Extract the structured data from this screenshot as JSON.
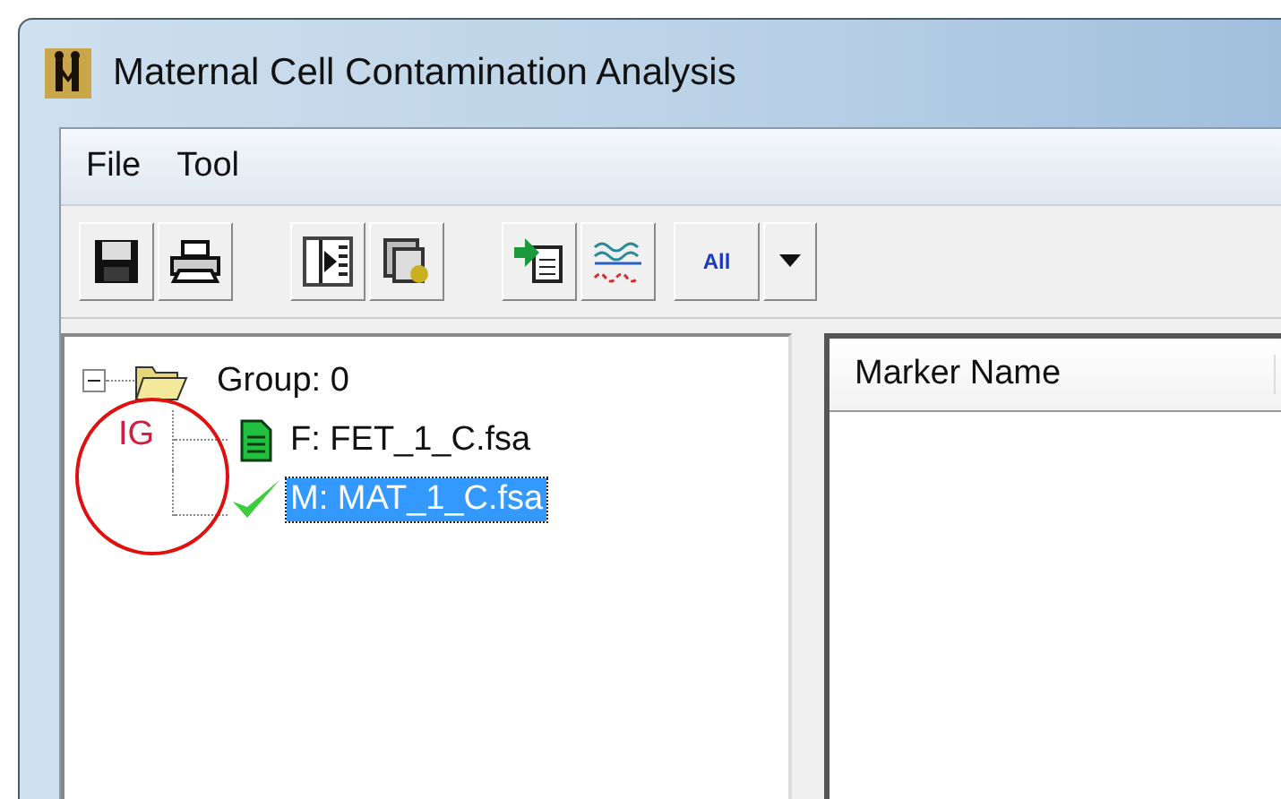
{
  "window": {
    "title": "Maternal Cell Contamination Analysis"
  },
  "menu": [
    {
      "label": "File"
    },
    {
      "label": "Tool"
    }
  ],
  "toolbar": {
    "all_label": "All"
  },
  "tree": {
    "label": "Group: 0",
    "expanded": true,
    "children": [
      {
        "label": "F: FET_1_C.fsa",
        "kind": "file",
        "selected": false
      },
      {
        "label": "M: MAT_1_C.fsa",
        "kind": "checked",
        "selected": true
      }
    ]
  },
  "annotation": {
    "label": "IG"
  },
  "table": {
    "columns": [
      "Marker Name"
    ]
  }
}
